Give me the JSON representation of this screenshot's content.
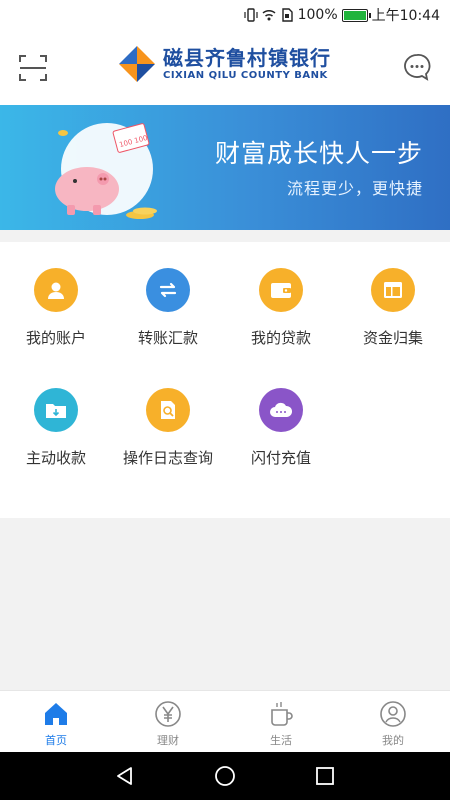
{
  "status_bar": {
    "battery": "100%",
    "time": "上午10:44",
    "icons": [
      "vibrate-icon",
      "wifi-icon",
      "sim-icon",
      "battery-icon"
    ]
  },
  "header": {
    "scan_icon": "scan-icon",
    "message_icon": "chat-bubble-icon",
    "logo_cn": "磁县齐鲁村镇银行",
    "logo_en": "CIXIAN QILU COUNTY BANK"
  },
  "banner": {
    "title": "财富成长快人一步",
    "subtitle": "流程更少，更快捷"
  },
  "menu": {
    "items": [
      {
        "label": "我的账户",
        "icon": "user-icon",
        "color": "#f7b02a"
      },
      {
        "label": "转账汇款",
        "icon": "transfer-icon",
        "color": "#3a8fe0"
      },
      {
        "label": "我的贷款",
        "icon": "wallet-icon",
        "color": "#f7b02a"
      },
      {
        "label": "资金归集",
        "icon": "layout-icon",
        "color": "#f7b02a"
      },
      {
        "label": "主动收款",
        "icon": "folder-download-icon",
        "color": "#2fb5d6"
      },
      {
        "label": "操作日志查询",
        "icon": "doc-search-icon",
        "color": "#f7b02a"
      },
      {
        "label": "闪付充值",
        "icon": "cloud-icon",
        "color": "#8a55c8"
      }
    ]
  },
  "tabbar": {
    "tabs": [
      {
        "label": "首页",
        "icon": "home-icon",
        "active": true
      },
      {
        "label": "理财",
        "icon": "yuan-icon",
        "active": false
      },
      {
        "label": "生活",
        "icon": "cup-icon",
        "active": false
      },
      {
        "label": "我的",
        "icon": "profile-icon",
        "active": false
      }
    ]
  },
  "colors": {
    "accent": "#1e7ce8",
    "brand": "#1f4fa0"
  }
}
